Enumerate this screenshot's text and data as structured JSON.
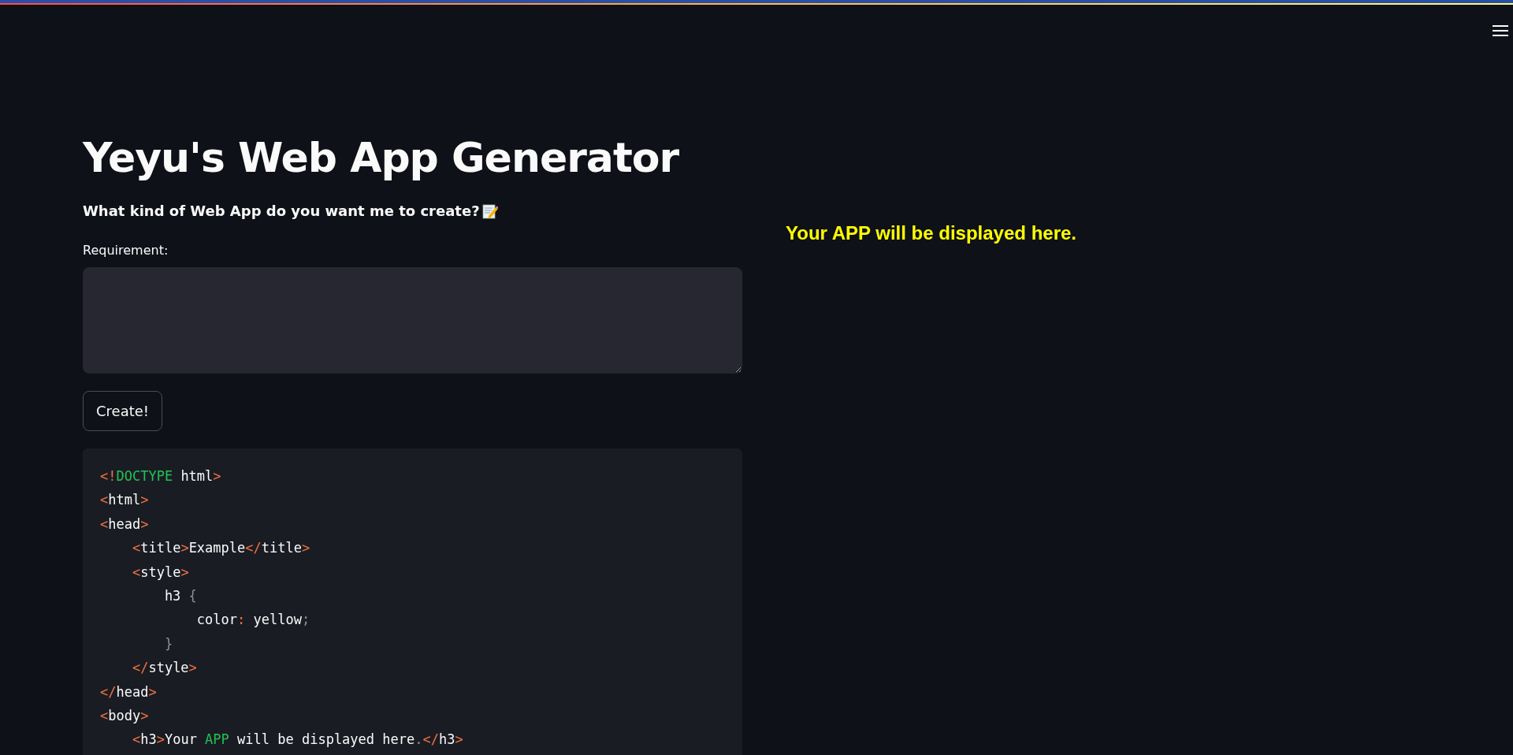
{
  "title": "Yeyu's Web App Generator",
  "subtitle": "What kind of Web App do you want me to create?",
  "requirement": {
    "label": "Requirement:"
  },
  "button": "Create!",
  "code_lines": [
    [
      {
        "kind": "tag",
        "text": "<!"
      },
      {
        "kind": "keyword",
        "text": "DOCTYPE"
      },
      {
        "kind": "text",
        "text": " html"
      },
      {
        "kind": "tag",
        "text": ">"
      }
    ],
    [
      {
        "kind": "tag",
        "text": "<"
      },
      {
        "kind": "text",
        "text": "html"
      },
      {
        "kind": "tag",
        "text": ">"
      }
    ],
    [
      {
        "kind": "tag",
        "text": "<"
      },
      {
        "kind": "text",
        "text": "head"
      },
      {
        "kind": "tag",
        "text": ">"
      }
    ],
    [
      {
        "kind": "tag",
        "text": "    <"
      },
      {
        "kind": "text",
        "text": "title"
      },
      {
        "kind": "tag",
        "text": ">"
      },
      {
        "kind": "text",
        "text": "Example"
      },
      {
        "kind": "tag",
        "text": "</"
      },
      {
        "kind": "text",
        "text": "title"
      },
      {
        "kind": "tag",
        "text": ">"
      }
    ],
    [
      {
        "kind": "tag",
        "text": "    <"
      },
      {
        "kind": "text",
        "text": "style"
      },
      {
        "kind": "tag",
        "text": ">"
      }
    ],
    [
      {
        "kind": "text",
        "text": "        h3 "
      },
      {
        "kind": "punct",
        "text": "{"
      }
    ],
    [
      {
        "kind": "text",
        "text": "            color"
      },
      {
        "kind": "tag",
        "text": ":"
      },
      {
        "kind": "text",
        "text": " yellow"
      },
      {
        "kind": "punct",
        "text": ";"
      }
    ],
    [
      {
        "kind": "punct",
        "text": "        }"
      }
    ],
    [
      {
        "kind": "tag",
        "text": "    </"
      },
      {
        "kind": "text",
        "text": "style"
      },
      {
        "kind": "tag",
        "text": ">"
      }
    ],
    [
      {
        "kind": "tag",
        "text": "</"
      },
      {
        "kind": "text",
        "text": "head"
      },
      {
        "kind": "tag",
        "text": ">"
      }
    ],
    [
      {
        "kind": "tag",
        "text": "<"
      },
      {
        "kind": "text",
        "text": "body"
      },
      {
        "kind": "tag",
        "text": ">"
      }
    ],
    [
      {
        "kind": "tag",
        "text": "    <"
      },
      {
        "kind": "text",
        "text": "h3"
      },
      {
        "kind": "tag",
        "text": ">"
      },
      {
        "kind": "text",
        "text": "Your "
      },
      {
        "kind": "keyword",
        "text": "APP"
      },
      {
        "kind": "text",
        "text": " will be displayed here"
      },
      {
        "kind": "punct",
        "text": "."
      },
      {
        "kind": "tag",
        "text": "</"
      },
      {
        "kind": "text",
        "text": "h3"
      },
      {
        "kind": "tag",
        "text": ">"
      }
    ]
  ],
  "preview_text": "Your APP will be displayed here."
}
